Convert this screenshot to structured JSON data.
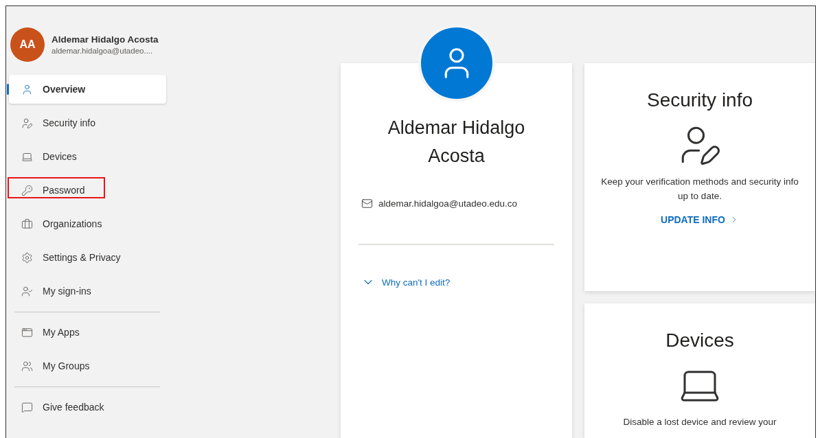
{
  "profile": {
    "initials": "AA",
    "name": "Aldemar Hidalgo Acosta",
    "email": "aldemar.hidalgoa@utadeo...."
  },
  "sidebar": {
    "sections": [
      {
        "items": [
          {
            "label": "Overview",
            "selected": true,
            "highlighted": false
          },
          {
            "label": "Security info",
            "selected": false,
            "highlighted": false
          },
          {
            "label": "Devices",
            "selected": false,
            "highlighted": false
          },
          {
            "label": "Password",
            "selected": false,
            "highlighted": true
          },
          {
            "label": "Organizations",
            "selected": false,
            "highlighted": false
          },
          {
            "label": "Settings & Privacy",
            "selected": false,
            "highlighted": false
          },
          {
            "label": "My sign-ins",
            "selected": false,
            "highlighted": false
          }
        ]
      },
      {
        "items": [
          {
            "label": "My Apps",
            "selected": false,
            "highlighted": false
          },
          {
            "label": "My Groups",
            "selected": false,
            "highlighted": false
          }
        ]
      },
      {
        "items": [
          {
            "label": "Give feedback",
            "selected": false,
            "highlighted": false
          }
        ]
      }
    ]
  },
  "profile_card": {
    "name": "Aldemar Hidalgo Acosta",
    "email": "aldemar.hidalgoa@utadeo.edu.co",
    "why_link": "Why can't I edit?"
  },
  "security_card": {
    "title": "Security info",
    "description": "Keep your verification methods and security info up to date.",
    "link": "UPDATE INFO"
  },
  "devices_card": {
    "title": "Devices",
    "description": "Disable a lost device and review your"
  }
}
